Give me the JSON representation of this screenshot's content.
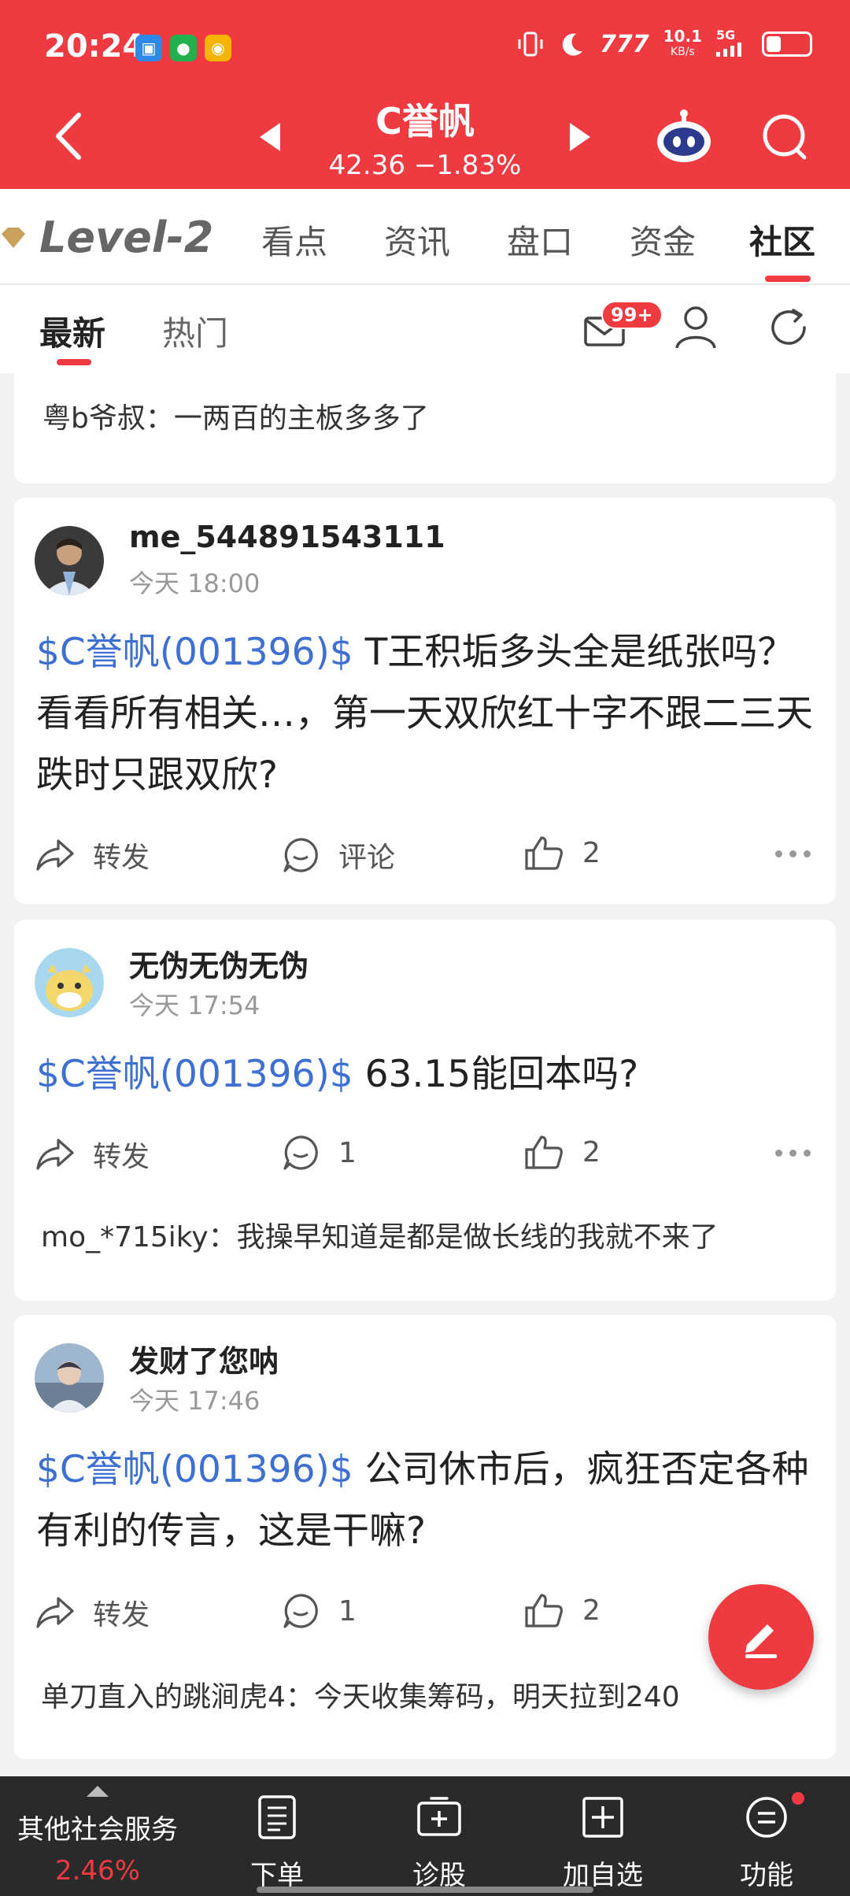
{
  "status_bar": {
    "time": "20:24",
    "network_speed": "10.1",
    "network_unit": "KB/s",
    "signal": "5G",
    "battery_level": 0.35
  },
  "header": {
    "stock_name": "C誉帆",
    "quote": "42.36 −1.83%",
    "bg_color": "#ee3a40"
  },
  "main_tabs": {
    "level2_label": "Level-2",
    "tabs": [
      "看点",
      "资讯",
      "盘口",
      "资金",
      "社区"
    ],
    "active": "社区"
  },
  "sub_tabs": {
    "tabs": [
      "最新",
      "热门"
    ],
    "active": "最新",
    "mail_badge": "99+"
  },
  "top_card": {
    "reply": "粤b爷叔：一两百的主板多多了"
  },
  "posts": [
    {
      "username": "me_544891543111",
      "time": "今天 18:00",
      "stock_tag": "$C誉帆(001396)$",
      "text": " T王积垢多头全是纸张吗？看看所有相关…，第一天双欣红十字不跟二三天跌时只跟双欣?",
      "forward_label": "转发",
      "comment_label": "评论",
      "likes": "2"
    },
    {
      "username": "无伪无伪无伪",
      "time": "今天 17:54",
      "stock_tag": "$C誉帆(001396)$",
      "text": " 63.15能回本吗?",
      "forward_label": "转发",
      "comment_label": "1",
      "likes": "2",
      "reply": "mo_*715iky：我操早知道是都是做长线的我就不来了"
    },
    {
      "username": "发财了您呐",
      "time": "今天 17:46",
      "stock_tag": "$C誉帆(001396)$",
      "text": " 公司休市后，疯狂否定各种有利的传言，这是干嘛?",
      "forward_label": "转发",
      "comment_label": "1",
      "likes": "2",
      "reply": "单刀直入的跳涧虎4：今天收集筹码，明天拉到240"
    }
  ],
  "bottom_nav": {
    "other_services": "其他社会服务",
    "other_services_pct": "2.46%",
    "items": [
      "下单",
      "诊股",
      "加自选",
      "功能"
    ]
  },
  "icons": {
    "back": "back-arrow-icon",
    "search": "search-icon",
    "robot": "robot-assistant-icon",
    "mail": "mail-icon",
    "person": "person-icon",
    "refresh": "refresh-icon",
    "forward": "forward-icon",
    "comment": "comment-icon",
    "like": "thumbs-up-icon",
    "compose": "pencil-icon"
  }
}
